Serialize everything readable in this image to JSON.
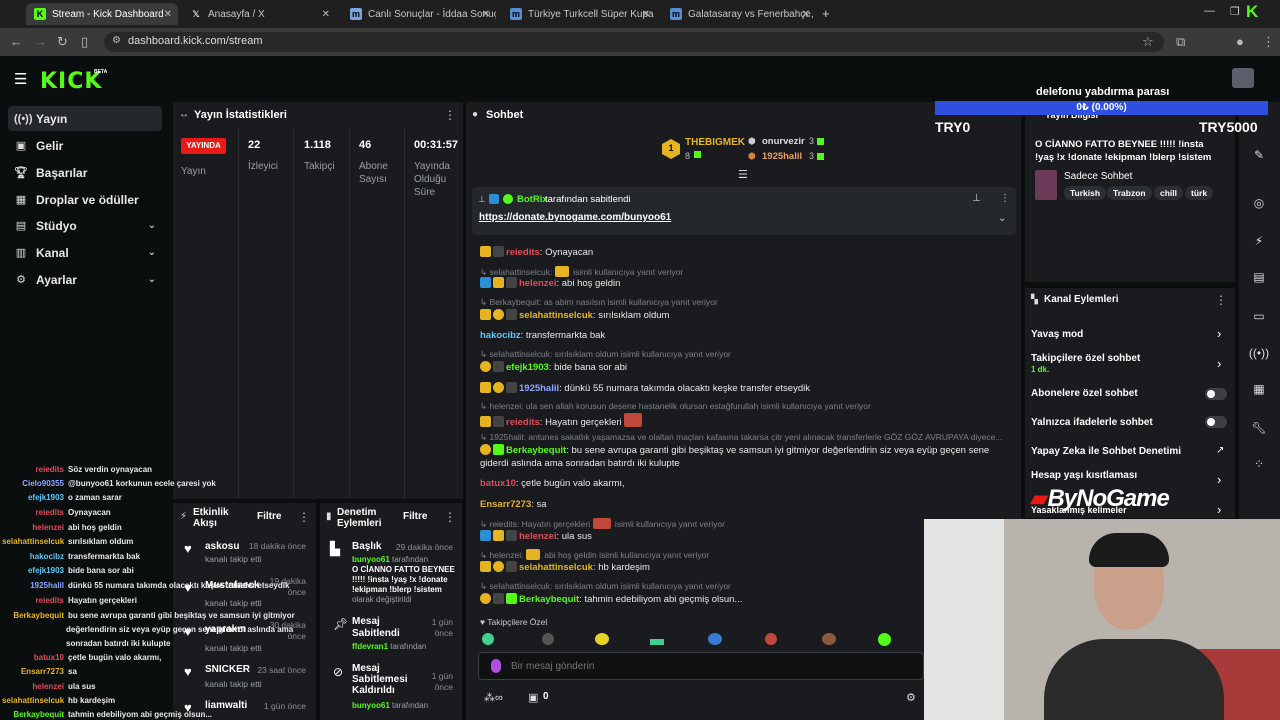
{
  "browser": {
    "tabs": [
      {
        "title": "Stream - Kick Dashboard",
        "active": true
      },
      {
        "title": "Anasayfa / X"
      },
      {
        "title": "Canlı Sonuçlar - İddaa Sonuçla..."
      },
      {
        "title": "Türkiye Turkcell Süper Kupa 20..."
      },
      {
        "title": "Galatasaray vs Fenerbahçe, 10.0..."
      }
    ],
    "url": "dashboard.kick.com/stream"
  },
  "brand": {
    "logo": "KICK",
    "beta": "BETA"
  },
  "sidebar": {
    "items": [
      {
        "label": "Yayın",
        "icon": "stream-icon"
      },
      {
        "label": "Gelir",
        "icon": "revenue-icon"
      },
      {
        "label": "Başarılar",
        "icon": "trophy-icon"
      },
      {
        "label": "Droplar ve ödüller",
        "icon": "gift-icon"
      },
      {
        "label": "Stüdyo",
        "icon": "studio-icon"
      },
      {
        "label": "Kanal",
        "icon": "channel-icon"
      },
      {
        "label": "Ayarlar",
        "icon": "gear-icon"
      }
    ]
  },
  "stats": {
    "title": "Yayın İstatistikleri",
    "live_badge": "YAYINDA",
    "live_label": "Yayın",
    "viewers": "22",
    "viewers_label": "İzleyici",
    "followers": "1.118",
    "followers_label": "Takipçi",
    "subs": "46",
    "subs_label": "Abone Sayısı",
    "uptime": "00:31:57",
    "uptime_label": "Yayında Olduğu Süre"
  },
  "activity": {
    "title": "Etkinlik Akışı",
    "filter": "Filtre",
    "items": [
      {
        "name": "askosu",
        "time": "18 dakika önce",
        "sub": "kanalı takip etti"
      },
      {
        "name": "Mustafaeck",
        "time": "19 dakika önce",
        "sub": "kanalı takip etti"
      },
      {
        "name": "yaprakm",
        "time": "30 dakika önce",
        "sub": "kanalı takip etti"
      },
      {
        "name": "SNICKER",
        "time": "23 saat önce",
        "sub": "kanalı takip etti"
      },
      {
        "name": "liamwalti",
        "time": "1 gün önce",
        "sub": ""
      }
    ]
  },
  "moderation": {
    "title": "Denetim Eylemleri",
    "filter": "Filtre",
    "items": [
      {
        "title": "Başlık",
        "time": "29 dakika önce",
        "user": "bunyoo61",
        "rest": " tarafından",
        "detail1": "O CİANNO FATTO BEYNEE",
        "detail2": "!!!!! !insta !yaş !x !donate",
        "detail3": "!ekipman !blerp !sistem",
        "detail4": "olarak değiştirildi"
      },
      {
        "title1": "Mesaj",
        "title2": "Sabitlendi",
        "time1": "1 gün",
        "time2": "önce",
        "user": "ffdevran1",
        "rest": " tarafından"
      },
      {
        "title1": "Mesaj",
        "title2": "Sabitlemesi",
        "title3": "Kaldırıldı",
        "time1": "1 gün",
        "time2": "önce",
        "user": "bunyoo61",
        "rest": " tarafından"
      }
    ]
  },
  "chat": {
    "title": "Sohbet",
    "top1": {
      "rank": "1",
      "name": "THEBIGMEK",
      "count": "8"
    },
    "top2": {
      "name": "onurvezir",
      "count": "3"
    },
    "top3": {
      "name": "1925halil",
      "count": "3"
    },
    "pinned_by": "BotRix",
    "pinned_suffix": "tarafından sabitlendi",
    "pinned_link": "https://donate.bynogame.com/bunyoo61",
    "followers_only": "Takipçilere Özel",
    "input_placeholder": "Bir mesaj gönderin",
    "points": "0",
    "messages": [
      {
        "u": "reiedits",
        "t": ": Oynayacan"
      },
      {
        "r": "selahattinselcuk:",
        "r2": "isimli kullanıcıya yanıt veriyor"
      },
      {
        "u": "helenzei",
        "t": ": abi hoş geldin"
      },
      {
        "r": "Berkaybequit: as abim nasılsın isimli kullanıcıya yanıt veriyor"
      },
      {
        "u": "selahattinselcuk",
        "t": ": sırılsıklam oldum"
      },
      {
        "u": "hakocibz",
        "t": ": transfermarkta bak"
      },
      {
        "r": "selahattinselcuk: sırılsıklam oldum isimli kullanıcıya yanıt veriyor"
      },
      {
        "u": "efejk1903",
        "t": ": bide bana sor abi"
      },
      {
        "u": "1925halil",
        "t": ": dünkü 55 numara takımda olacaktı keşke transfer etseydik"
      },
      {
        "r": "helenzei: ula sen allah korusun desene hastanelik olursan estağfurullah isimli kullanıcıya yanıt veriyor"
      },
      {
        "u": "reiedits",
        "t": ": Hayatın gerçekleri"
      },
      {
        "r": "1925halil: antunes sakatlık yaşamazsa ve olaltan maçları kafasına takarsa çitr yeni alınacak transferlerle GÖZ GÖZ AVRUPAYA diyece..."
      },
      {
        "u": "Berkaybequit",
        "t": ": bu sene avrupa garanti gibi beşiktaş ve samsun iyi gitmiyor değerlendirin siz veya eyüp geçen sene"
      },
      {
        "t2": "giderdi aslında ama sonradan batırdı iki kulupte"
      },
      {
        "u": "batux10",
        "t": ": çetle bugün valo akarmı,"
      },
      {
        "u": "Ensarr7273",
        "t": ": sa"
      },
      {
        "r": "reiedits: Hayatın gerçekleri",
        "r2": "isimli kullanıcıya yanıt veriyor"
      },
      {
        "u": "helenzei",
        "t": ": ula sus"
      },
      {
        "r": "helenzei:",
        "r2": "abi hoş geldin isimli kullanıcıya yanıt veriyor"
      },
      {
        "u": "selahattinselcuk",
        "t": ": hb kardeşim"
      },
      {
        "r": "selahattinselcuk: sırılsıklam oldum isimli kullanıcıya yanıt veriyor"
      },
      {
        "u": "Berkaybequit",
        "t": ": tahmin edebiliyom abi geçmiş olsun..."
      }
    ]
  },
  "overlay": {
    "goal_title": "delefonu yabdırma parası",
    "goal_progress": "0₺ (0.00%)",
    "goal_progress_pct": 0,
    "goal_start": "TRY0",
    "goal_end": "TRY5000",
    "watermark": "ByNoGame",
    "chat": [
      {
        "u": "reiedits",
        "t": "Söz verdin oynayacan"
      },
      {
        "u": "Cielo90355",
        "t": "@bunyoo61 korkunun ecele çaresi yok"
      },
      {
        "u": "efejk1903",
        "t": "o zaman sarar"
      },
      {
        "u": "reiedits",
        "t": "Oynayacan"
      },
      {
        "u": "helenzei",
        "t": "abi hoş geldin"
      },
      {
        "u": "selahattinselcuk",
        "t": "sırılsıklam oldum"
      },
      {
        "u": "hakocibz",
        "t": "transfermarkta bak"
      },
      {
        "u": "efejk1903",
        "t": "bide bana sor abi"
      },
      {
        "u": "1925halil",
        "t": "dünkü 55 numara takımda olacaktı keşke transfer etseydik"
      },
      {
        "u": "reiedits",
        "t": "Hayatın gerçekleri"
      },
      {
        "u": "Berkaybequit",
        "t": "bu sene avrupa garanti gibi beşiktaş ve samsun iyi gitmiyor"
      },
      {
        "t": "değerlendirin siz veya eyüp geçen sene giderdi aslında ama"
      },
      {
        "t": "sonradan batırdı iki kulupte"
      },
      {
        "u": "batux10",
        "t": "çetle bugün valo akarmı,"
      },
      {
        "u": "Ensarr7273",
        "t": "sa"
      },
      {
        "u": "helenzei",
        "t": "ula sus"
      },
      {
        "u": "selahattinselcuk",
        "t": "hb kardeşim"
      },
      {
        "u": "Berkaybequit",
        "t": "tahmin edebiliyom abi geçmiş olsun..."
      }
    ]
  },
  "stream_info": {
    "title": "Yayın Bilgisi",
    "stream_title": "O CİANNO FATTO BEYNEE !!!!! !insta !yaş !x !donate !ekipman !blerp !sistem",
    "category": "Sadece Sohbet",
    "tags": [
      "Turkish",
      "Trabzon",
      "chill",
      "türk"
    ]
  },
  "channel_actions": {
    "title": "Kanal Eylemleri",
    "slow": "Yavaş mod",
    "followers": "Takipçilere özel sohbet",
    "followers_sub": "1 dk.",
    "subs": "Abonelere özel sohbet",
    "emotes": "Yalnızca ifadelerle sohbet",
    "ai": "Yapay Zeka ile Sohbet Denetimi",
    "age": "Hesap yaşı kısıtlaması",
    "banned": "Yasaklanmış kelimeler"
  },
  "colors": {
    "kick_green": "#53fc18",
    "live_red": "#e91916",
    "goal_blue": "#2f4fe0"
  }
}
